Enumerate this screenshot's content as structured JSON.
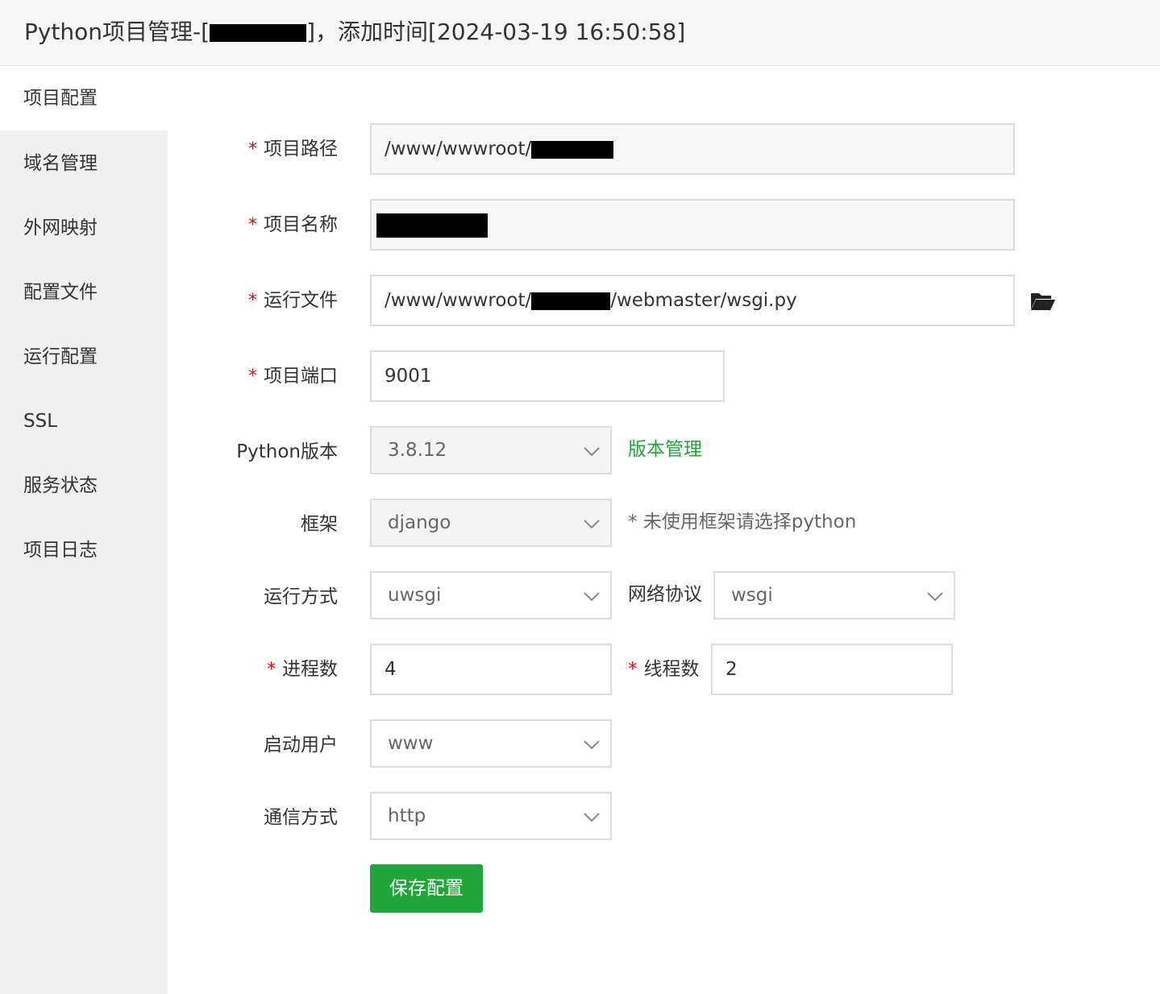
{
  "header": {
    "title_prefix": "Python项目管理-[",
    "title_suffix": "]，添加时间[2024-03-19 16:50:58]"
  },
  "sidebar": {
    "items": [
      {
        "label": "项目配置",
        "active": true
      },
      {
        "label": "域名管理",
        "active": false
      },
      {
        "label": "外网映射",
        "active": false
      },
      {
        "label": "配置文件",
        "active": false
      },
      {
        "label": "运行配置",
        "active": false
      },
      {
        "label": "SSL",
        "active": false
      },
      {
        "label": "服务状态",
        "active": false
      },
      {
        "label": "项目日志",
        "active": false
      }
    ]
  },
  "form": {
    "required_mark": "*",
    "project_path": {
      "label": "项目路径",
      "value_prefix": "/www/wwwroot/"
    },
    "project_name": {
      "label": "项目名称"
    },
    "run_file": {
      "label": "运行文件",
      "value_prefix": "/www/wwwroot/",
      "value_suffix": "/webmaster/wsgi.py"
    },
    "project_port": {
      "label": "项目端口",
      "value": "9001"
    },
    "python_version": {
      "label": "Python版本",
      "value": "3.8.12",
      "link": "版本管理"
    },
    "framework": {
      "label": "框架",
      "value": "django",
      "hint": "* 未使用框架请选择python"
    },
    "run_mode": {
      "label": "运行方式",
      "value": "uwsgi"
    },
    "network_protocol": {
      "label": "网络协议",
      "value": "wsgi"
    },
    "processes": {
      "label": "进程数",
      "value": "4"
    },
    "threads": {
      "label": "线程数",
      "value": "2"
    },
    "start_user": {
      "label": "启动用户",
      "value": "www"
    },
    "comm_mode": {
      "label": "通信方式",
      "value": "http"
    },
    "save_label": "保存配置"
  },
  "colors": {
    "accent": "#20a53a",
    "required": "#ef0808"
  },
  "icons": {
    "browse": "folder-open-icon",
    "dropdown": "chevron-down-icon"
  }
}
